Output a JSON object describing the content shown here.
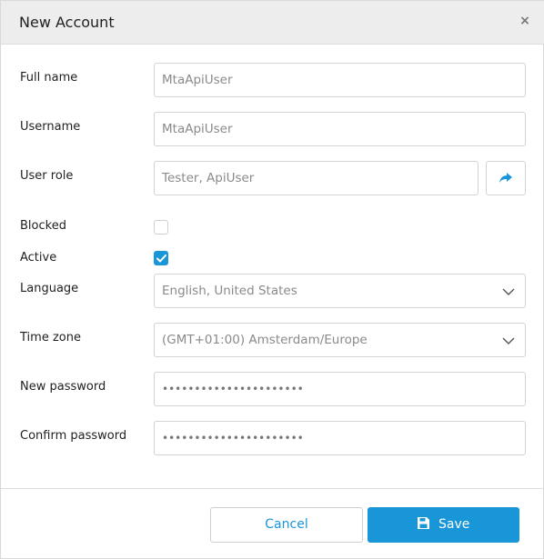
{
  "dialog": {
    "title": "New Account",
    "close_label": "×"
  },
  "fields": {
    "full_name": {
      "label": "Full name",
      "value": "MtaApiUser"
    },
    "username": {
      "label": "Username",
      "value": "MtaApiUser"
    },
    "user_role": {
      "label": "User role",
      "value": "Tester, ApiUser",
      "action_icon": "share-arrow-icon"
    },
    "blocked": {
      "label": "Blocked",
      "checked": false
    },
    "active": {
      "label": "Active",
      "checked": true
    },
    "language": {
      "label": "Language",
      "value": "English, United States"
    },
    "time_zone": {
      "label": "Time zone",
      "value": "(GMT+01:00) Amsterdam/Europe"
    },
    "new_password": {
      "label": "New password",
      "value": "••••••••••••••••••••••"
    },
    "confirm_password": {
      "label": "Confirm password",
      "value": "••••••••••••••••••••••"
    }
  },
  "footer": {
    "cancel_label": "Cancel",
    "save_label": "Save",
    "save_icon": "floppy-disk-icon"
  },
  "colors": {
    "accent": "#1996d8",
    "header_bg": "#ededed",
    "border": "#d3d3d3"
  }
}
